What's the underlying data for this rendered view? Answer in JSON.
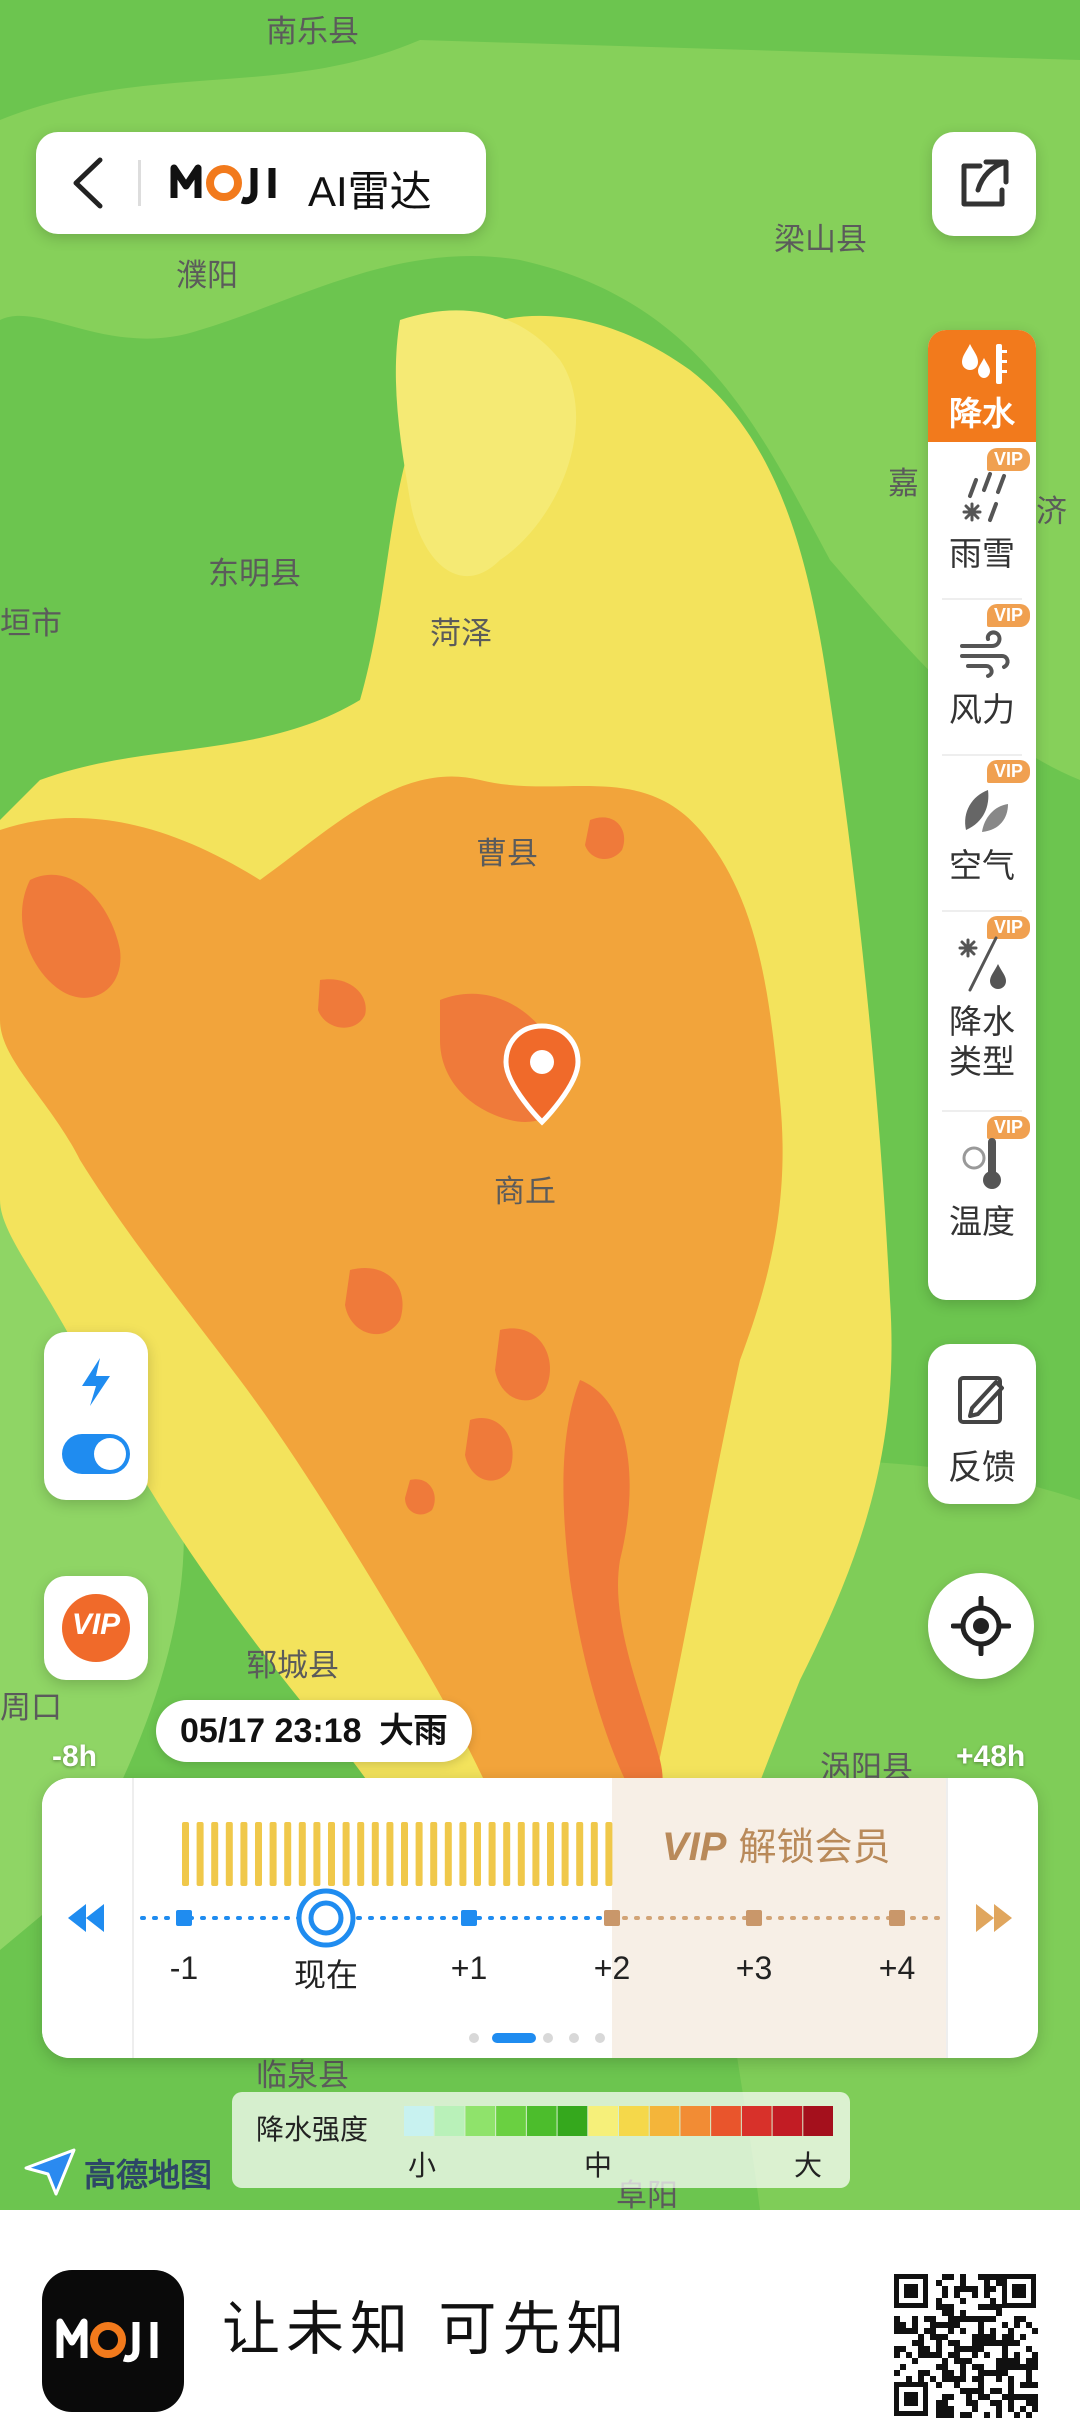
{
  "map": {
    "labels": [
      "南乐县",
      "濮阳",
      "梁山县",
      "东明县",
      "垣市",
      "菏泽",
      "嘉",
      "济",
      "曹县",
      "商丘",
      "郓城县",
      "周口",
      "涡阳县",
      "临泉县",
      "阜阳"
    ],
    "colors": {
      "green": "#6cc54f",
      "light_green": "#9ad86a",
      "yellow": "#f3e35c",
      "orange": "#f2a43b",
      "red_orange": "#ef7a3a"
    }
  },
  "header": {
    "back_icon": "back-chevron-icon",
    "brand": "MOJI",
    "title": "AI雷达"
  },
  "share": {
    "icon": "share-icon"
  },
  "layers": [
    {
      "id": "precip",
      "label": "降水",
      "vip": "",
      "icon": "rain-drop-icon",
      "active": true
    },
    {
      "id": "rainsnow",
      "label": "雨雪",
      "vip": "VIP",
      "icon": "rain-snow-icon"
    },
    {
      "id": "wind",
      "label": "风力",
      "vip": "VIP",
      "icon": "wind-icon"
    },
    {
      "id": "air",
      "label": "空气",
      "vip": "VIP",
      "icon": "leaf-icon"
    },
    {
      "id": "ptype",
      "label": "降水\n类型",
      "vip": "VIP",
      "icon": "snow-drop-icon"
    },
    {
      "id": "temp",
      "label": "温度",
      "vip": "VIP",
      "icon": "thermometer-icon"
    }
  ],
  "feedback": {
    "label": "反馈",
    "icon": "edit-icon"
  },
  "locate": {
    "icon": "locate-icon"
  },
  "lightning": {
    "icon": "lightning-icon",
    "toggle_on": true
  },
  "vip_button": {
    "label": "VIP"
  },
  "time_bubble": {
    "datetime": "05/17 23:18",
    "weather": "大雨"
  },
  "edge_labels": {
    "left": "-8h",
    "right": "+48h"
  },
  "timeline": {
    "vip_badge": "VIP",
    "vip_text": "解锁会员",
    "ticks": [
      "-1",
      "现在",
      "+1",
      "+2",
      "+3",
      "+4"
    ],
    "current_index": 1,
    "locked_from_index": 3,
    "page_dots": 5,
    "active_dot": 1
  },
  "legend": {
    "title": "降水强度",
    "low": "小",
    "mid": "中",
    "high": "大",
    "colors": [
      "#c8f2f0",
      "#b9f1b9",
      "#8fe36b",
      "#6ad041",
      "#4cbd2c",
      "#35a81d",
      "#f6f07a",
      "#f5d84a",
      "#f4b53a",
      "#f28c34",
      "#e9552c",
      "#d8312a",
      "#c21c24",
      "#a4101c"
    ]
  },
  "attribution": {
    "text": "高德地图",
    "icon": "amap-logo-icon"
  },
  "footer": {
    "brand": "MOJI",
    "slogan": "让未知 可先知",
    "qr_icon": "qr-code-icon"
  }
}
